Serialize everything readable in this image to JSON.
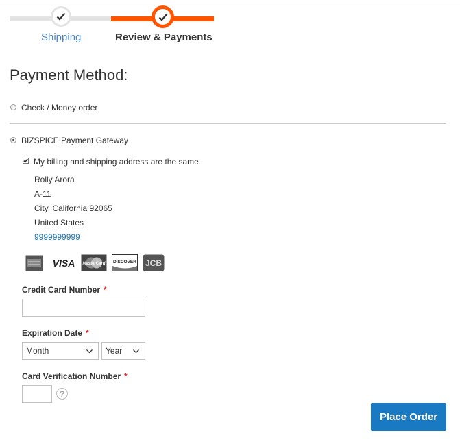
{
  "steps": [
    {
      "label": "Shipping",
      "state": "complete"
    },
    {
      "label": "Review & Payments",
      "state": "active"
    }
  ],
  "colors": {
    "accent": "#ff5501",
    "link": "#4d86c5",
    "primary_button": "#1979c3",
    "required": "#e02b27"
  },
  "payment": {
    "title": "Payment Method:",
    "methods": [
      {
        "label": "Check / Money order",
        "selected": false
      },
      {
        "label": "BIZSPICE Payment Gateway",
        "selected": true
      }
    ],
    "same_address_label": "My billing and shipping address are the same",
    "same_address_checked": true,
    "address": {
      "name": "Rolly Arora",
      "street": "A-11",
      "city_line": "City, California 92065",
      "country": "United States",
      "phone": "9999999999"
    },
    "card_icons": [
      "amex-icon",
      "visa-icon",
      "mastercard-icon",
      "discover-icon",
      "jcb-icon"
    ],
    "card_texts": {
      "visa": "VISA",
      "mastercard": "MasterCard",
      "discover": "DISCOVER",
      "jcb": "JCB"
    },
    "cc_number_label": "Credit Card Number",
    "expiration_label": "Expiration Date",
    "month_value": "Month",
    "year_value": "Year",
    "cvv_label": "Card Verification Number",
    "required_mark": "*",
    "help_glyph": "?"
  },
  "place_order_label": "Place Order"
}
